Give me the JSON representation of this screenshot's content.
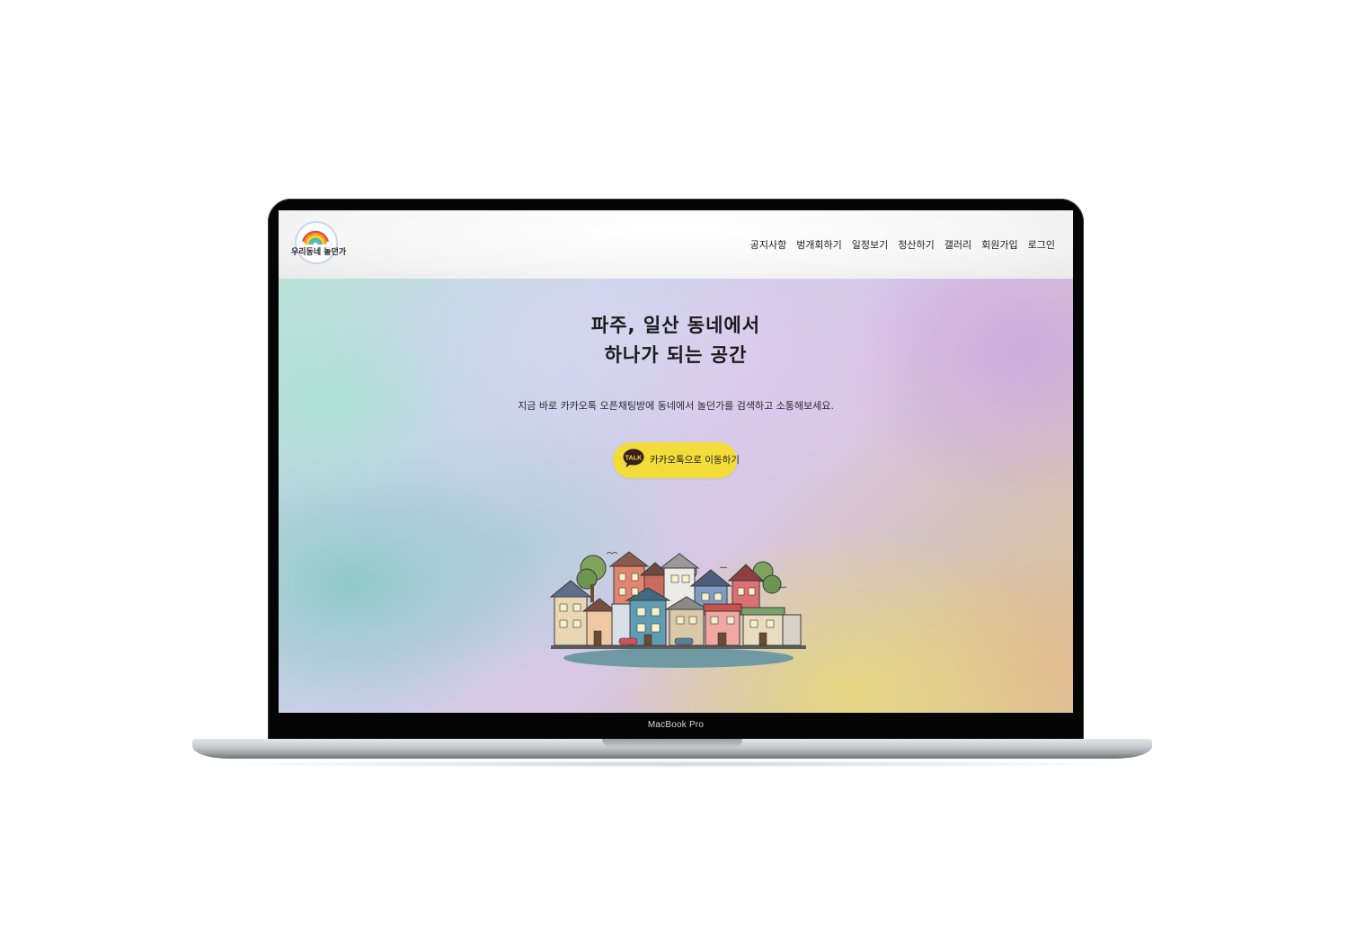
{
  "site": {
    "logo_text": "우리동네 놀던가"
  },
  "nav": {
    "items": [
      {
        "label": "공지사항"
      },
      {
        "label": "벙개회하기"
      },
      {
        "label": "일정보기"
      },
      {
        "label": "정산하기"
      },
      {
        "label": "갤러리"
      },
      {
        "label": "회원가입"
      },
      {
        "label": "로그인"
      }
    ]
  },
  "hero": {
    "title_line1": "파주, 일산 동네에서",
    "title_line2": "하나가 되는 공간",
    "subtitle": "지금 바로 카카오톡 오픈채팅방에 동네에서 놀던가를 검색하고 소통해보세요.",
    "kakao_button_label": "카카오톡으로 이동하기",
    "kakao_icon_text": "TALK"
  },
  "device": {
    "label": "MacBook Pro"
  },
  "colors": {
    "kakao_yellow": "#f2dc3a",
    "text_dark": "#1a1a1a"
  },
  "icons": {
    "logo": "rainbow-logo-icon",
    "kakao": "kakao-talk-icon",
    "illustration": "village-houses-illustration"
  }
}
